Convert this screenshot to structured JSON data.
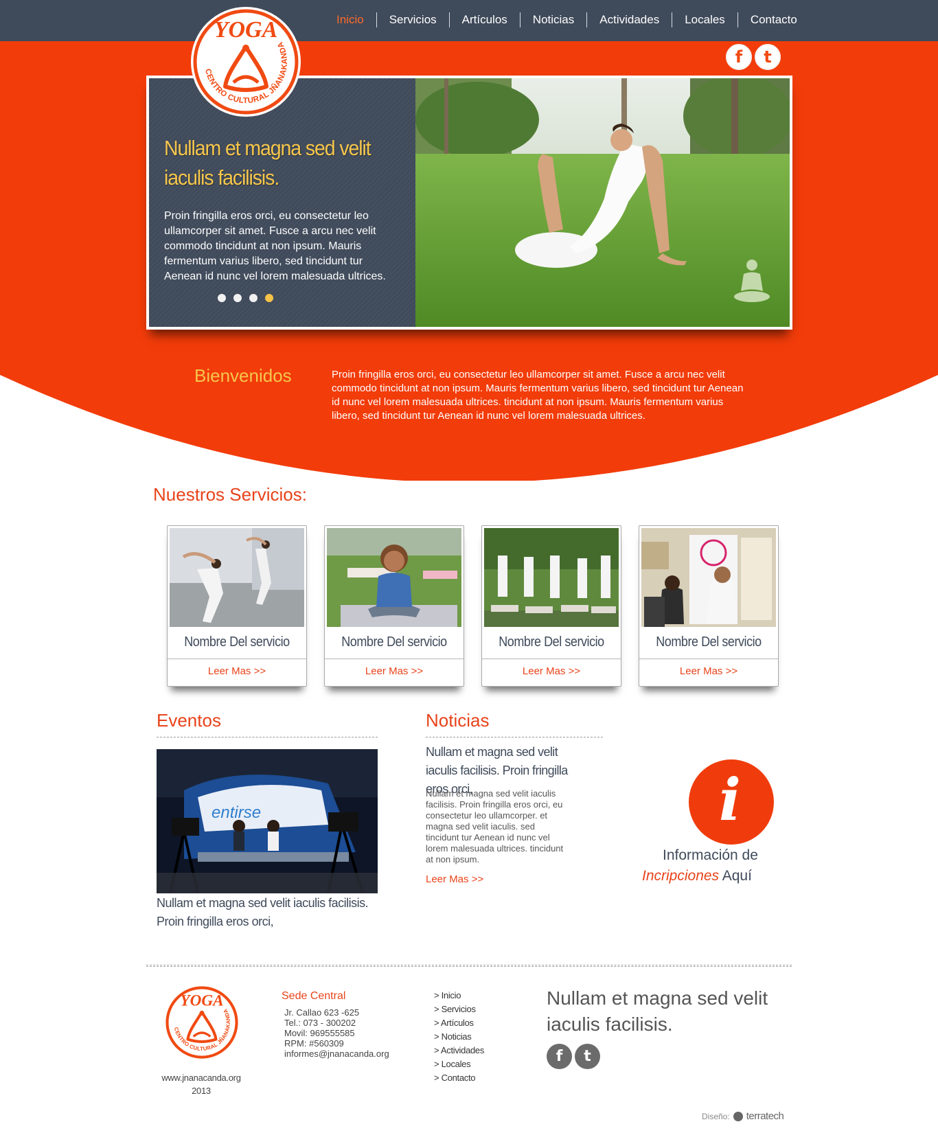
{
  "nav": {
    "items": [
      "Inicio",
      "Servicios",
      "Artículos",
      "Noticias",
      "Actividades",
      "Locales",
      "Contacto"
    ],
    "active": "Inicio"
  },
  "logo": {
    "word": "YOGA",
    "ring_text": "CENTRO CULTURAL JÑANAKANDA"
  },
  "social": {
    "facebook_icon": "f",
    "twitter_icon": "t"
  },
  "slider": {
    "title": "Nullam et magna sed velit iaculis facilisis.",
    "text": "Proin fringilla eros orci, eu consectetur leo ullamcorper sit amet. Fusce a arcu nec velit commodo tincidunt at non ipsum. Mauris fermentum varius libero, sed tincidunt tur Aenean id nunc vel lorem malesuada ultrices.",
    "dot_count": 4,
    "active_dot": 4
  },
  "welcome": {
    "title": "Bienvenidos",
    "text": "Proin fringilla eros orci, eu consectetur leo ullamcorper sit amet. Fusce a arcu nec velit commodo tincidunt at non ipsum. Mauris fermentum varius libero, sed tincidunt tur Aenean id nunc vel lorem malesuada ultrices. tincidunt at non ipsum. Mauris fermentum varius libero, sed tincidunt tur Aenean id nunc vel lorem malesuada ultrices."
  },
  "services": {
    "title": "Nuestros Servicios:",
    "cards": [
      {
        "name": "Nombre Del servicio",
        "more": "Leer Mas >>"
      },
      {
        "name": "Nombre Del servicio",
        "more": "Leer Mas >>"
      },
      {
        "name": "Nombre Del servicio",
        "more": "Leer Mas >>"
      },
      {
        "name": "Nombre Del servicio",
        "more": "Leer Mas >>"
      }
    ]
  },
  "events": {
    "title": "Eventos",
    "caption": "Nullam et magna sed velit iaculis facilisis. Proin fringilla eros orci,"
  },
  "news": {
    "title": "Noticias",
    "headline": "Nullam et magna sed velit iaculis facilisis. Proin fringilla eros orci,",
    "body": "Nullam et magna sed velit iaculis facilisis. Proin fringilla eros orci, eu consectetur leo ullamcorper. et magna sed velit iaculis. sed tincidunt tur Aenean id nunc vel lorem malesuada ultrices. tincidunt at non ipsum.",
    "more": "Leer Mas >>"
  },
  "info": {
    "icon": "i",
    "line1": "Información de",
    "highlight": "Incripciones",
    "line2_rest": " Aquí"
  },
  "footer": {
    "site": "www.jnanacanda.org",
    "year": "2013",
    "sede_title": "Sede Central",
    "sede_lines": [
      "Jr. Callao 623 -625",
      "Tel.: 073 - 300202",
      "Movil: 969555585",
      "RPM: #560309",
      "informes@jnanacanda.org"
    ],
    "nav": [
      "> Inicio",
      "> Servicios",
      "> Artículos",
      "> Noticias",
      "> Actividades",
      "> Locales",
      "> Contacto"
    ],
    "tagline": "Nullam et magna sed velit iaculis facilisis.",
    "credit_label": "Diseño:",
    "credit_brand": "terratech"
  },
  "colors": {
    "nav_bg": "#3f4a5a",
    "orange": "#f23c0a",
    "accent_red": "#e8431a",
    "gold": "#f6c64c"
  }
}
